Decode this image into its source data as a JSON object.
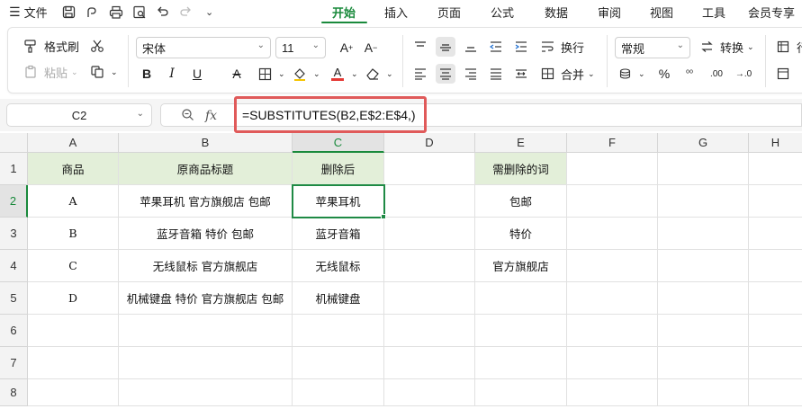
{
  "menubar": {
    "file_label": "文件",
    "tabs": [
      "开始",
      "插入",
      "页面",
      "公式",
      "数据",
      "审阅",
      "视图",
      "工具",
      "会员专享"
    ],
    "active_tab": "开始"
  },
  "ribbon": {
    "format_painter": "格式刷",
    "paste": "粘贴",
    "font_name": "宋体",
    "font_size": "11",
    "wrap": "换行",
    "merge": "合并",
    "number_format": "常规",
    "convert": "转换",
    "row_col_partial": "行"
  },
  "formula_bar": {
    "name_box": "C2",
    "formula": "=SUBSTITUTES(B2,E$2:E$4,)"
  },
  "columns": [
    "A",
    "B",
    "C",
    "D",
    "E",
    "F",
    "G",
    "H"
  ],
  "rows": [
    "1",
    "2",
    "3",
    "4",
    "5",
    "6",
    "7",
    "8"
  ],
  "cells": {
    "A": [
      "商品",
      "A",
      "B",
      "C",
      "D",
      "",
      "",
      ""
    ],
    "B": [
      "原商品标题",
      "苹果耳机 官方旗舰店 包邮",
      "蓝牙音箱 特价 包邮",
      "无线鼠标 官方旗舰店",
      "机械键盘 特价 官方旗舰店 包邮",
      "",
      "",
      ""
    ],
    "C": [
      "删除后",
      "苹果耳机",
      "蓝牙音箱",
      "无线鼠标",
      "机械键盘",
      "",
      "",
      ""
    ],
    "D": [
      "",
      "",
      "",
      "",
      "",
      "",
      "",
      ""
    ],
    "E": [
      "需删除的词",
      "包邮",
      "特价",
      "官方旗舰店",
      "",
      "",
      "",
      ""
    ],
    "F": [
      "",
      "",
      "",
      "",
      "",
      "",
      "",
      ""
    ],
    "G": [
      "",
      "",
      "",
      "",
      "",
      "",
      "",
      ""
    ],
    "H": [
      "",
      "",
      "",
      "",
      "",
      "",
      "",
      ""
    ]
  },
  "colors": {
    "accent": "#1a8a3c",
    "header_fill": "#e3efd9",
    "annotation_box": "#e05a5a"
  }
}
